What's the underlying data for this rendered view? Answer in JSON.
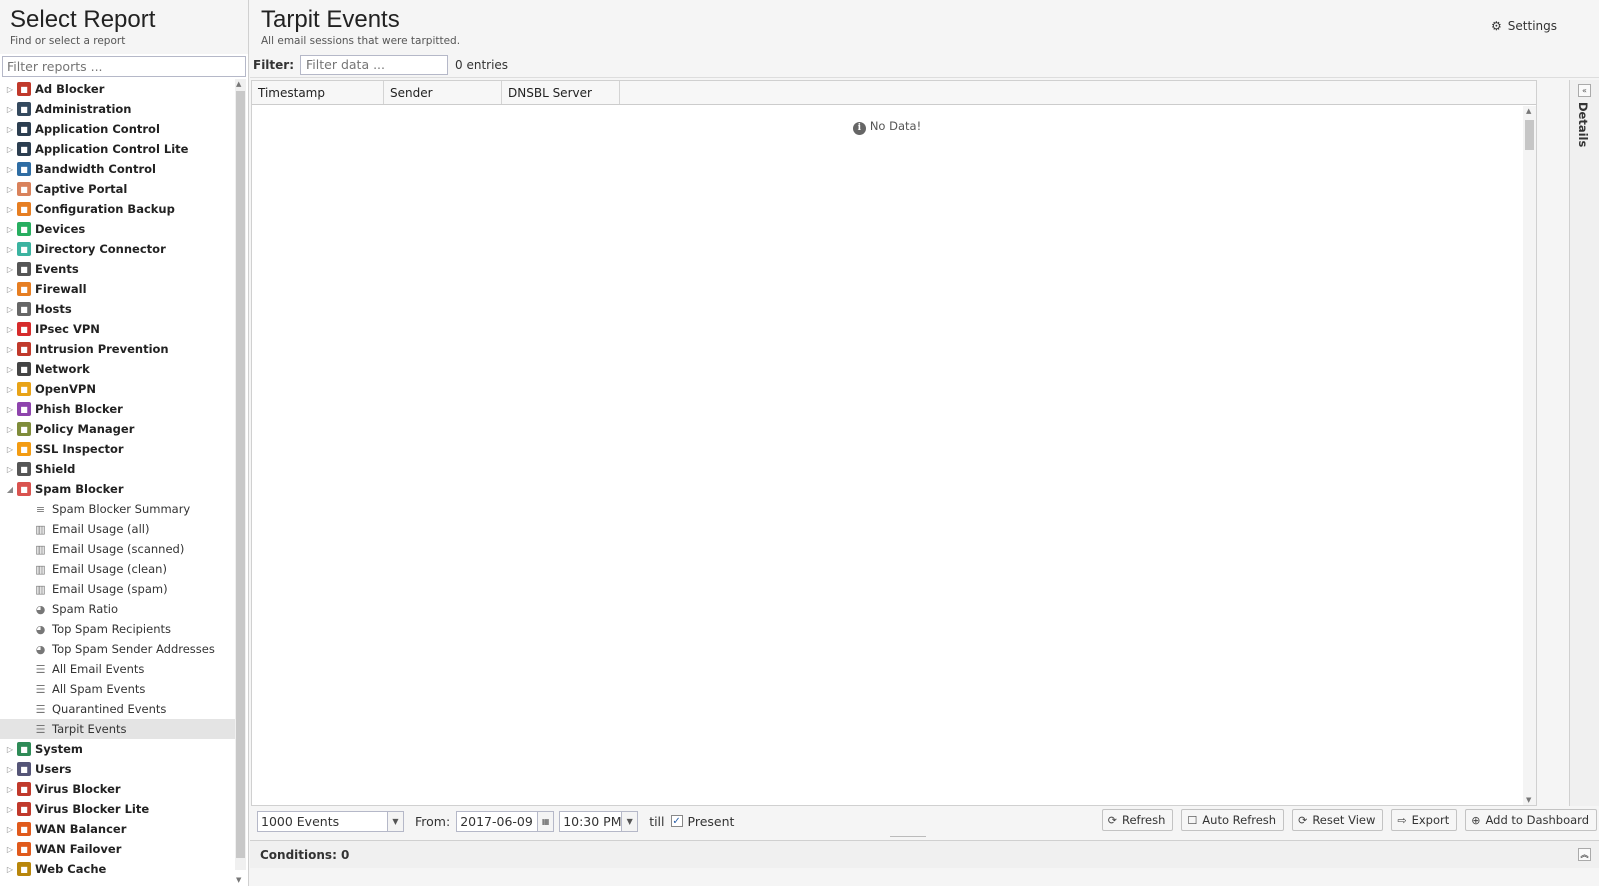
{
  "left": {
    "title": "Select Report",
    "subtitle": "Find or select a report",
    "filter_placeholder": "Filter reports ...",
    "apps": [
      {
        "label": "Ad Blocker",
        "icon": "ad-blocker-icon",
        "color": "#c0392b"
      },
      {
        "label": "Administration",
        "icon": "administration-icon",
        "color": "#34495e"
      },
      {
        "label": "Application Control",
        "icon": "application-control-icon",
        "color": "#2c3e50"
      },
      {
        "label": "Application Control Lite",
        "icon": "application-control-lite-icon",
        "color": "#2c3e50"
      },
      {
        "label": "Bandwidth Control",
        "icon": "bandwidth-control-icon",
        "color": "#2e6da4"
      },
      {
        "label": "Captive Portal",
        "icon": "captive-portal-icon",
        "color": "#d9825b"
      },
      {
        "label": "Configuration Backup",
        "icon": "configuration-backup-icon",
        "color": "#e67e22"
      },
      {
        "label": "Devices",
        "icon": "devices-icon",
        "color": "#27ae60"
      },
      {
        "label": "Directory Connector",
        "icon": "directory-connector-icon",
        "color": "#3bb3a0"
      },
      {
        "label": "Events",
        "icon": "events-icon",
        "color": "#555555"
      },
      {
        "label": "Firewall",
        "icon": "firewall-icon",
        "color": "#e67e22"
      },
      {
        "label": "Hosts",
        "icon": "hosts-icon",
        "color": "#666666"
      },
      {
        "label": "IPsec VPN",
        "icon": "ipsec-vpn-icon",
        "color": "#d62c2c"
      },
      {
        "label": "Intrusion Prevention",
        "icon": "intrusion-prevention-icon",
        "color": "#c0392b"
      },
      {
        "label": "Network",
        "icon": "network-icon",
        "color": "#444444"
      },
      {
        "label": "OpenVPN",
        "icon": "openvpn-icon",
        "color": "#e8a317"
      },
      {
        "label": "Phish Blocker",
        "icon": "phish-blocker-icon",
        "color": "#8e44ad"
      },
      {
        "label": "Policy Manager",
        "icon": "policy-manager-icon",
        "color": "#7f8c3a"
      },
      {
        "label": "SSL Inspector",
        "icon": "ssl-inspector-icon",
        "color": "#f39c12"
      },
      {
        "label": "Shield",
        "icon": "shield-icon",
        "color": "#555555"
      },
      {
        "label": "Spam Blocker",
        "icon": "spam-blocker-icon",
        "color": "#d9534f",
        "expanded": true
      }
    ],
    "spam_children": [
      {
        "label": "Spam Blocker Summary",
        "icon": "text-lines-icon",
        "glyph": "≡"
      },
      {
        "label": "Email Usage (all)",
        "icon": "bar-chart-icon",
        "glyph": "▥"
      },
      {
        "label": "Email Usage (scanned)",
        "icon": "bar-chart-icon",
        "glyph": "▥"
      },
      {
        "label": "Email Usage (clean)",
        "icon": "bar-chart-icon",
        "glyph": "▥"
      },
      {
        "label": "Email Usage (spam)",
        "icon": "bar-chart-icon",
        "glyph": "▥"
      },
      {
        "label": "Spam Ratio",
        "icon": "pie-chart-icon",
        "glyph": "◕"
      },
      {
        "label": "Top Spam Recipients",
        "icon": "pie-chart-icon",
        "glyph": "◕"
      },
      {
        "label": "Top Spam Sender Addresses",
        "icon": "pie-chart-icon",
        "glyph": "◕"
      },
      {
        "label": "All Email Events",
        "icon": "list-icon",
        "glyph": "☰"
      },
      {
        "label": "All Spam Events",
        "icon": "list-icon",
        "glyph": "☰"
      },
      {
        "label": "Quarantined Events",
        "icon": "list-icon",
        "glyph": "☰"
      },
      {
        "label": "Tarpit Events",
        "icon": "list-icon",
        "glyph": "☰",
        "selected": true
      }
    ],
    "apps_after": [
      {
        "label": "System",
        "icon": "system-icon",
        "color": "#2e8b57"
      },
      {
        "label": "Users",
        "icon": "users-icon",
        "color": "#555577"
      },
      {
        "label": "Virus Blocker",
        "icon": "virus-blocker-icon",
        "color": "#c0392b"
      },
      {
        "label": "Virus Blocker Lite",
        "icon": "virus-blocker-lite-icon",
        "color": "#c0392b"
      },
      {
        "label": "WAN Balancer",
        "icon": "wan-balancer-icon",
        "color": "#e05a1c"
      },
      {
        "label": "WAN Failover",
        "icon": "wan-failover-icon",
        "color": "#e05a1c"
      },
      {
        "label": "Web Cache",
        "icon": "web-cache-icon",
        "color": "#b8860b"
      }
    ]
  },
  "main": {
    "title": "Tarpit Events",
    "subtitle": "All email sessions that were tarpitted.",
    "settings_label": "Settings",
    "filter_label": "Filter:",
    "filter_placeholder": "Filter data ...",
    "entries": "0 entries",
    "columns": [
      "Timestamp",
      "Sender",
      "DNSBL Server"
    ],
    "no_data": "No Data!",
    "details_label": "Details"
  },
  "toolbar": {
    "events_limit": "1000 Events",
    "from_label": "From:",
    "from_date": "2017-06-09",
    "from_time": "10:30 PM",
    "till_label": "till",
    "present_label": "Present",
    "present_checked": true,
    "refresh": "Refresh",
    "auto_refresh": "Auto Refresh",
    "reset_view": "Reset View",
    "export": "Export",
    "add_dashboard": "Add to Dashboard"
  },
  "conditions": "Conditions: 0"
}
